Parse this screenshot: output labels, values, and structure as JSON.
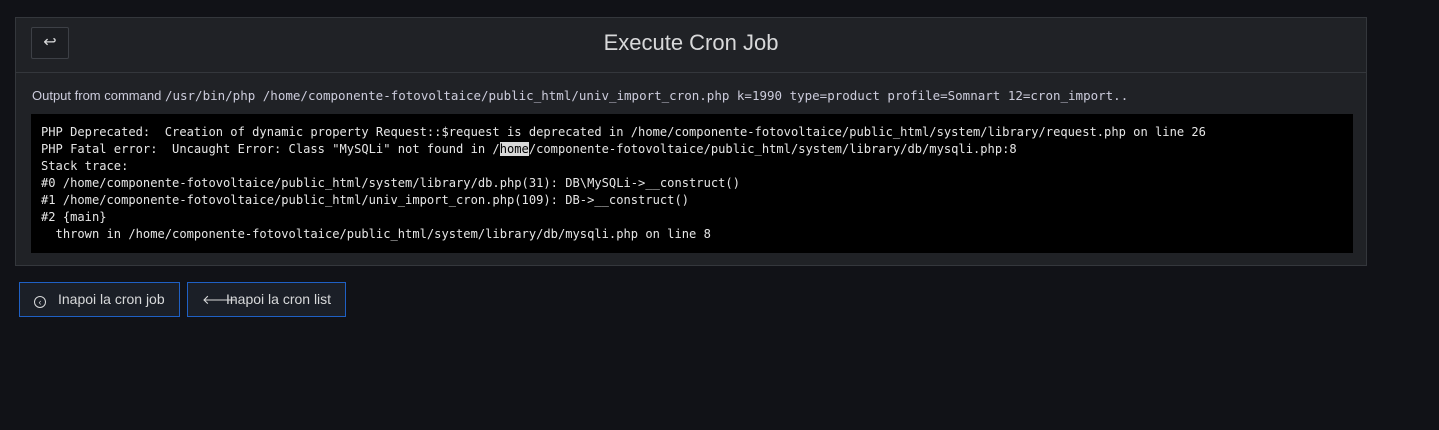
{
  "header": {
    "title": "Execute Cron Job",
    "back_icon": "↩"
  },
  "command": {
    "prefix": "Output from command",
    "text": "/usr/bin/php /home/componente-fotovoltaice/public_html/univ_import_cron.php k=1990 type=product profile=Somnart 12=cron_import.."
  },
  "output": {
    "lines": [
      "PHP Deprecated:  Creation of dynamic property Request::$request is deprecated in /home/componente-fotovoltaice/public_html/system/library/request.php on line 26",
      "PHP Fatal error:  Uncaught Error: Class \"MySQLi\" not found in /",
      "home",
      "/componente-fotovoltaice/public_html/system/library/db/mysqli.php:8",
      "Stack trace:",
      "#0 /home/componente-fotovoltaice/public_html/system/library/db.php(31): DB\\MySQLi->__construct()",
      "#1 /home/componente-fotovoltaice/public_html/univ_import_cron.php(109): DB->__construct()",
      "#2 {main}",
      "  thrown in /home/componente-fotovoltaice/public_html/system/library/db/mysqli.php on line 8"
    ]
  },
  "buttons": {
    "back_to_job": {
      "label": "Inapoi la cron job",
      "icon": "circle-left-icon"
    },
    "back_to_list": {
      "label": "Inapoi la cron list",
      "icon": "arrow-left-icon"
    }
  }
}
